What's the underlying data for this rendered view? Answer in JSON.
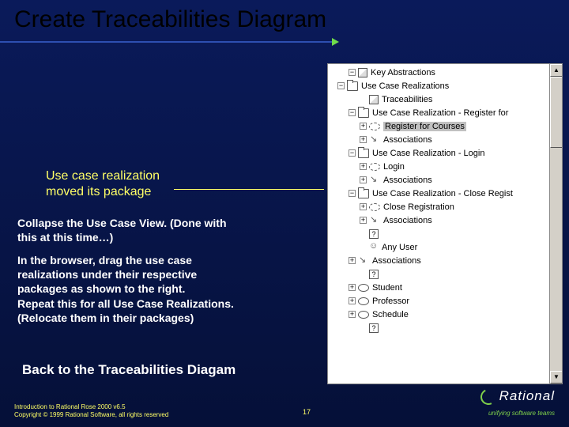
{
  "title": "Create Traceabilities Diagram",
  "callout": {
    "line1": "Use case realization",
    "line2": "moved its package"
  },
  "para1": {
    "l1": "Collapse the Use Case View.  (Done with",
    "l2": " this at this time…)"
  },
  "para2": {
    "l1": "In the browser, drag the use case",
    "l2": " realizations under their respective",
    "l3": " packages as shown to the right.",
    "l4": "Repeat this for all Use Case Realizations.",
    "l5": " (Relocate them in their packages)"
  },
  "backlink": "Back to the Traceabilities Diagam",
  "footer": {
    "l1": "Introduction to Rational Rose 2000 v6.5",
    "l2": "Copyright © 1999 Rational Software, all rights reserved"
  },
  "page": "17",
  "logo": {
    "brand": "Rational",
    "tagline": "unifying software teams"
  },
  "tree": {
    "items": [
      {
        "indent": 24,
        "exp": "-",
        "icon": "class",
        "label": "Key Abstractions"
      },
      {
        "indent": 10,
        "exp": "-",
        "icon": "folder",
        "label": "Use Case Realizations"
      },
      {
        "indent": 38,
        "exp": "",
        "icon": "class",
        "label": "Traceabilities"
      },
      {
        "indent": 24,
        "exp": "-",
        "icon": "folder",
        "label": "Use Case Realization - Register for"
      },
      {
        "indent": 38,
        "exp": "+",
        "icon": "uc-dashed",
        "label": "Register for Courses",
        "selected": true
      },
      {
        "indent": 38,
        "exp": "+",
        "icon": "assoc",
        "label": "Associations"
      },
      {
        "indent": 24,
        "exp": "-",
        "icon": "folder",
        "label": "Use Case Realization - Login"
      },
      {
        "indent": 38,
        "exp": "+",
        "icon": "uc-dashed",
        "label": "Login"
      },
      {
        "indent": 38,
        "exp": "+",
        "icon": "assoc",
        "label": "Associations"
      },
      {
        "indent": 24,
        "exp": "-",
        "icon": "folder",
        "label": "Use Case Realization - Close Regist"
      },
      {
        "indent": 38,
        "exp": "+",
        "icon": "uc-dashed",
        "label": "Close Registration"
      },
      {
        "indent": 38,
        "exp": "+",
        "icon": "assoc",
        "label": "Associations"
      },
      {
        "indent": 38,
        "exp": "",
        "icon": "q",
        "label": ""
      },
      {
        "indent": 38,
        "exp": "",
        "icon": "actor",
        "label": "Any User"
      },
      {
        "indent": 24,
        "exp": "+",
        "icon": "assoc",
        "label": "Associations"
      },
      {
        "indent": 38,
        "exp": "",
        "icon": "q",
        "label": ""
      },
      {
        "indent": 24,
        "exp": "+",
        "icon": "uc",
        "label": "Student"
      },
      {
        "indent": 24,
        "exp": "+",
        "icon": "uc",
        "label": "Professor"
      },
      {
        "indent": 24,
        "exp": "+",
        "icon": "uc",
        "label": "Schedule"
      },
      {
        "indent": 38,
        "exp": "",
        "icon": "q",
        "label": ""
      }
    ]
  }
}
